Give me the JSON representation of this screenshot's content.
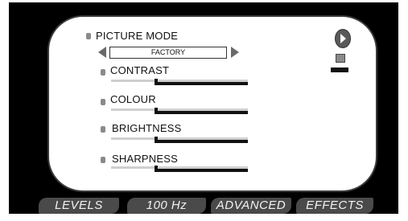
{
  "picture_mode": {
    "label": "PICTURE MODE",
    "value": "FACTORY"
  },
  "settings": [
    {
      "label": "CONTRAST",
      "level": 0.33
    },
    {
      "label": "COLOUR",
      "level": 0.33
    },
    {
      "label": "BRIGHTNESS",
      "level": 0.33
    },
    {
      "label": "SHARPNESS",
      "level": 0.33
    }
  ],
  "tabs": [
    {
      "label": "LEVELS"
    },
    {
      "label": "100 Hz"
    },
    {
      "label": "ADVANCED"
    },
    {
      "label": "EFFECTS"
    }
  ]
}
